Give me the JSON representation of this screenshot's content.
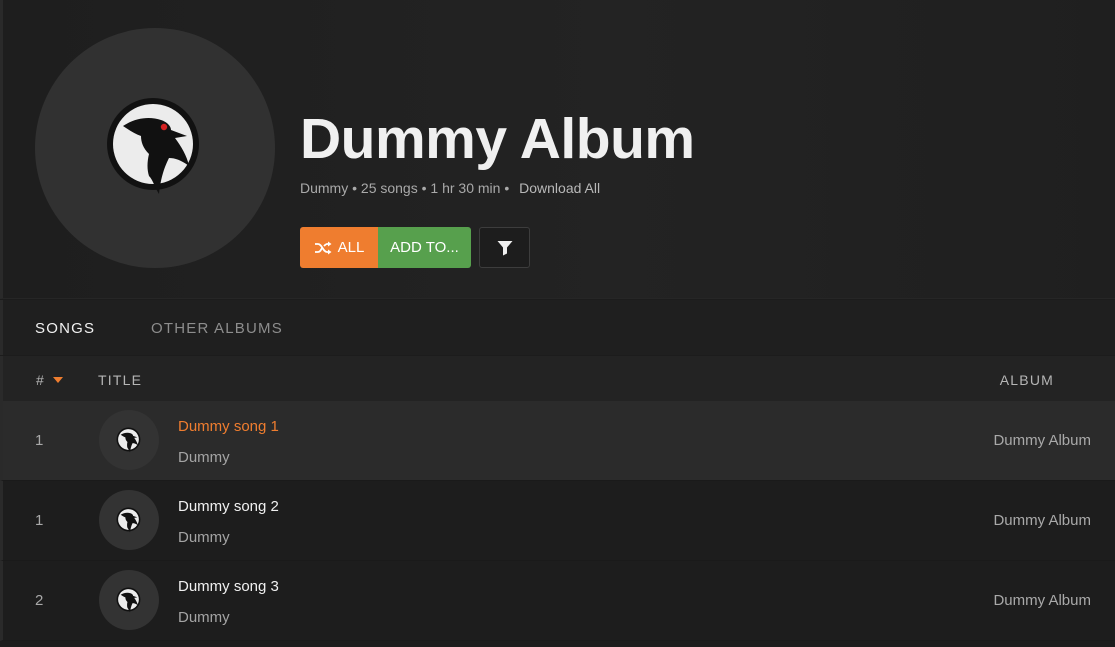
{
  "album": {
    "title": "Dummy Album",
    "meta": "Dummy • 25 songs • 1 hr 30 min •",
    "download_label": "Download All"
  },
  "actions": {
    "shuffle_label": "ALL",
    "add_label": "ADD TO...",
    "shuffle_icon": "shuffle-icon",
    "filter_icon": "filter-icon",
    "shuffle_color": "#ef7d2f",
    "add_color": "#57a04d"
  },
  "tabs": [
    {
      "label": "SONGS",
      "active": true
    },
    {
      "label": "OTHER ALBUMS",
      "active": false
    }
  ],
  "table": {
    "columns": {
      "number": "#",
      "title": "TITLE",
      "album": "ALBUM"
    },
    "sort_indicator": "caret-down-icon",
    "rows": [
      {
        "number": "1",
        "title": "Dummy song 1",
        "artist": "Dummy",
        "album": "Dummy Album",
        "active": true
      },
      {
        "number": "1",
        "title": "Dummy song 2",
        "artist": "Dummy",
        "album": "Dummy Album",
        "active": false
      },
      {
        "number": "2",
        "title": "Dummy song 3",
        "artist": "Dummy",
        "album": "Dummy Album",
        "active": false
      }
    ]
  },
  "accent_color": "#ef7d2f"
}
